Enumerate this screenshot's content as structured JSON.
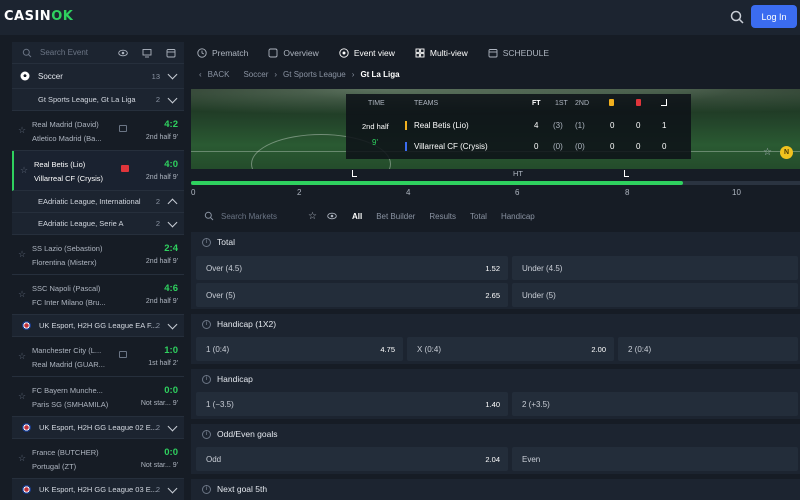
{
  "header": {
    "logo_main": "CASIN",
    "logo_ok": "OK",
    "login_label": "Log In"
  },
  "sidebar": {
    "search_placeholder": "Search Event",
    "sport": {
      "label": "Soccer",
      "count": "13"
    },
    "league1": {
      "label": "Gt Sports League, Gt La Liga",
      "count": "2"
    },
    "matches1": [
      {
        "team1": "Real Madrid (David)",
        "team2": "Atletico Madrid (Ba...",
        "score": "4:2",
        "status": "2nd half 9'"
      },
      {
        "team1": "Real Betis (Lio)",
        "team2": "Villarreal CF (Crysis)",
        "score": "4:0",
        "status": "2nd half 9'"
      }
    ],
    "league2": {
      "label": "EAdriatic League, International",
      "count": "2"
    },
    "league3": {
      "label": "EAdriatic League, Serie A",
      "count": "2"
    },
    "matches2": [
      {
        "team1": "SS Lazio (Sebastion)",
        "team2": "Florentina (Misterx)",
        "score": "2:4",
        "status": "2nd half 9'"
      },
      {
        "team1": "SSC Napoli (Pascal)",
        "team2": "FC Inter Milano (Bru...",
        "score": "4:6",
        "status": "2nd half 9'"
      }
    ],
    "league4": {
      "label": "UK Esport, H2H GG League EA F...",
      "count": "2"
    },
    "matches3": [
      {
        "team1": "Manchester City (L...",
        "team2": "Real Madrid (GUAR...",
        "score": "1:0",
        "status": "1st half 2'"
      },
      {
        "team1": "FC Bayern Munche...",
        "team2": "Paris SG (SMHAMILA)",
        "score": "0:0",
        "status": "Not star... 9'"
      }
    ],
    "league5": {
      "label": "UK Esport, H2H GG League 02 E...",
      "count": "2"
    },
    "matches4": [
      {
        "team1": "France (BUTCHER)",
        "team2": "Portugal (ZT)",
        "score": "0:0",
        "status": "Not star... 9'"
      }
    ],
    "league6": {
      "label": "UK Esport, H2H GG League 03 E...",
      "count": "2"
    }
  },
  "tabs": [
    "Prematch",
    "Overview",
    "Event view",
    "Multi-view",
    "SCHEDULE"
  ],
  "breadcrumb": {
    "back": "BACK",
    "sport": "Soccer",
    "league": "Gt Sports League",
    "current": "Gt La Liga"
  },
  "scoreboard": {
    "h_time": "TIME",
    "h_teams": "TEAMS",
    "h_ft": "FT",
    "h_1st": "1ST",
    "h_2nd": "2ND",
    "period": "2nd half",
    "minute": "9'",
    "home": {
      "name": "Real Betis (Lio)",
      "ft": "4",
      "first": "(3)",
      "second": "(1)",
      "yellow": "0",
      "red": "0",
      "corners": "1"
    },
    "away": {
      "name": "Villarreal CF (Crysis)",
      "ft": "0",
      "first": "(0)",
      "second": "(0)",
      "yellow": "0",
      "red": "0",
      "corners": "0"
    },
    "coin": "N",
    "colors": {
      "home": "#f1b01e",
      "away": "#3b6cf0"
    }
  },
  "timeline": {
    "ht_label": "HT",
    "ticks": [
      "0",
      "2",
      "4",
      "6",
      "8",
      "10"
    ],
    "progress": 0.808
  },
  "markets_bar": {
    "search_placeholder": "Search Markets",
    "filters": [
      "All",
      "Bet Builder",
      "Results",
      "Total",
      "Handicap"
    ]
  },
  "markets": {
    "total": {
      "title": "Total",
      "rows": [
        {
          "left": "Over (4.5)",
          "left_val": "1.52",
          "right": "Under (4.5)"
        },
        {
          "left": "Over (5)",
          "left_val": "2.65",
          "right": "Under (5)"
        }
      ]
    },
    "handicap1x2": {
      "title": "Handicap (1X2)",
      "o1": "1 (0:4)",
      "o1_val": "4.75",
      "o2": "X (0:4)",
      "o2_val": "2.00",
      "o3": "2 (0:4)"
    },
    "handicap": {
      "title": "Handicap",
      "left": "1 (−3.5)",
      "left_val": "1.40",
      "right": "2 (+3.5)"
    },
    "oddeven": {
      "title": "Odd/Even goals",
      "left": "Odd",
      "left_val": "2.04",
      "right": "Even"
    },
    "nextgoal": {
      "title": "Next goal 5th"
    }
  }
}
